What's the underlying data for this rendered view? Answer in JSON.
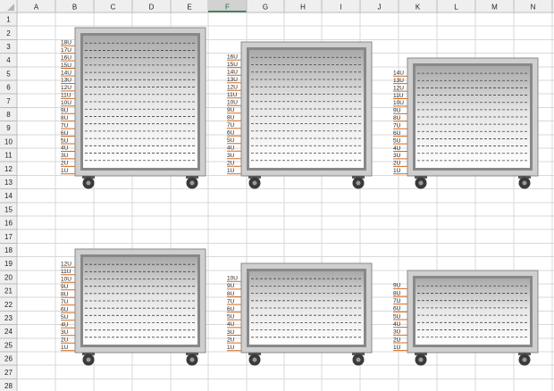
{
  "spreadsheet": {
    "columns": [
      "A",
      "B",
      "C",
      "D",
      "E",
      "F",
      "G",
      "H",
      "I",
      "J",
      "K",
      "L",
      "M",
      "N"
    ],
    "selected_column": "F",
    "rows": [
      "1",
      "2",
      "3",
      "4",
      "5",
      "6",
      "7",
      "8",
      "9",
      "10",
      "11",
      "12",
      "13",
      "14",
      "15",
      "16",
      "17",
      "18",
      "19",
      "20",
      "21",
      "22",
      "23",
      "24",
      "25",
      "26",
      "27",
      "28"
    ]
  },
  "racks": [
    {
      "id": "rack-18u",
      "units": 18,
      "labels": [
        "18U",
        "17U",
        "16U",
        "15U",
        "14U",
        "13U",
        "12U",
        "11U",
        "10U",
        "9U",
        "8U",
        "7U",
        "6U",
        "5U",
        "4U",
        "3U",
        "2U",
        "1U"
      ]
    },
    {
      "id": "rack-16u",
      "units": 16,
      "labels": [
        "16U",
        "15U",
        "14U",
        "13U",
        "12U",
        "11U",
        "10U",
        "9U",
        "8U",
        "7U",
        "6U",
        "5U",
        "4U",
        "3U",
        "2U",
        "1U"
      ]
    },
    {
      "id": "rack-14u",
      "units": 14,
      "labels": [
        "14U",
        "13U",
        "12U",
        "11U",
        "10U",
        "9U",
        "8U",
        "7U",
        "6U",
        "5U",
        "4U",
        "3U",
        "2U",
        "1U"
      ]
    },
    {
      "id": "rack-12u",
      "units": 12,
      "labels": [
        "12U",
        "11U",
        "10U",
        "9U",
        "8U",
        "7U",
        "6U",
        "5U",
        "4U",
        "3U",
        "2U",
        "1U"
      ]
    },
    {
      "id": "rack-10u",
      "units": 10,
      "labels": [
        "10U",
        "9U",
        "8U",
        "7U",
        "6U",
        "5U",
        "4U",
        "3U",
        "2U",
        "1U"
      ]
    },
    {
      "id": "rack-9u",
      "units": 9,
      "labels": [
        "9U",
        "8U",
        "7U",
        "6U",
        "5U",
        "4U",
        "3U",
        "2U",
        "1U"
      ]
    }
  ]
}
